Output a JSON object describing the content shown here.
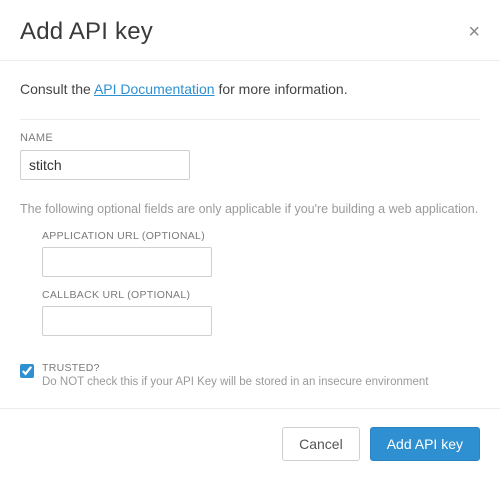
{
  "header": {
    "title": "Add API key",
    "close_label": "×"
  },
  "info": {
    "prefix": "Consult the ",
    "link_text": "API Documentation",
    "suffix": " for more information."
  },
  "fields": {
    "name": {
      "label": "NAME",
      "value": "stitch"
    },
    "helper": "The following optional fields are only applicable if you're building a web application.",
    "app_url": {
      "label": "APPLICATION URL (OPTIONAL)",
      "value": ""
    },
    "callback_url": {
      "label": "CALLBACK URL (OPTIONAL)",
      "value": ""
    },
    "trusted": {
      "label": "TRUSTED?",
      "note": "Do NOT check this if your API Key will be stored in an insecure environment",
      "checked": true
    }
  },
  "footer": {
    "cancel": "Cancel",
    "submit": "Add API key"
  }
}
